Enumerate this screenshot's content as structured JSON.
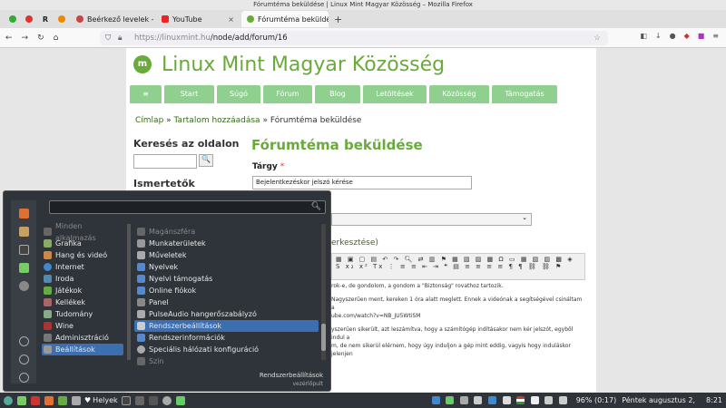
{
  "window": {
    "title": "Fórumtéma beküldése | Linux Mint Magyar Közösség – Mozilla Firefox"
  },
  "tabs": [
    {
      "label": "Beérkező levelek - "
    },
    {
      "label": "YouTube"
    },
    {
      "label": "Fórumtéma beküldé"
    }
  ],
  "nav": {
    "url_host": "https://linuxmint.hu",
    "url_path": "/node/add/forum/16"
  },
  "site": {
    "name": "Linux Mint Magyar Közösség",
    "logo_letter": "m",
    "menu": [
      "≡",
      "Start",
      "Súgó",
      "Fórum",
      "Blog",
      "Letöltések",
      "Közösség",
      "Támogatás"
    ],
    "breadcrumb": [
      "Címlap",
      "»",
      "Tartalom hozzáadása",
      "»",
      "Fórumtéma beküldése"
    ],
    "search_heading": "Keresés az oldalon",
    "search_button": "🔍",
    "ism_heading": "Ismertetők",
    "page_title": "Fórumtéma beküldése",
    "subject_label": "Tárgy",
    "required": "*",
    "subject_value": "Bejelentkezéskor jelszó kérése",
    "editor_link": "erkesztése)",
    "editor_text": [
      "rok-e, de gondolom, a gondom a \"Biztonság\" rovathoz tartozik.",
      "Nagyszerűen ment, kereken 1 óra alatt meglett. Ennek a videónak a segítségével csináltam a",
      "ube.com/watch?v=NB_JU5WtiSM",
      "yszerűen sikerült, azt leszámítva, hogy a számítógép indításakor nem kér jelszót, egyből indul a",
      "m, de nem sikerül elérnem, hogy úgy induljon a gép mint eddig, vagyis hogy induláskor jelenjen"
    ]
  },
  "launcher": {
    "categories": [
      {
        "label": "Minden alkalmazás",
        "dim": true
      },
      {
        "label": "Grafika"
      },
      {
        "label": "Hang és videó"
      },
      {
        "label": "Internet"
      },
      {
        "label": "Iroda"
      },
      {
        "label": "Játékok"
      },
      {
        "label": "Kellékek"
      },
      {
        "label": "Tudomány"
      },
      {
        "label": "Wine"
      },
      {
        "label": "Adminisztráció"
      },
      {
        "label": "Beállítások",
        "selected": true
      }
    ],
    "apps": [
      {
        "label": "Magánszféra",
        "dim": true
      },
      {
        "label": "Munkaterületek"
      },
      {
        "label": "Műveletek"
      },
      {
        "label": "Nyelvek"
      },
      {
        "label": "Nyelvi támogatás"
      },
      {
        "label": "Online fiókok"
      },
      {
        "label": "Panel"
      },
      {
        "label": "PulseAudio hangerőszabályzó"
      },
      {
        "label": "Rendszerbeállítások",
        "highlight": true
      },
      {
        "label": "Rendszerinformációk"
      },
      {
        "label": "Speciális hálózati konfiguráció"
      },
      {
        "label": "Szín",
        "dim": true
      }
    ],
    "description_title": "Rendszerbeállítások",
    "description_sub": "vezérlőpult"
  },
  "taskbar": {
    "places_label": "Helyek",
    "battery": "96% (0:17)",
    "date": "Péntek augusztus 2,",
    "time": "8:21"
  }
}
